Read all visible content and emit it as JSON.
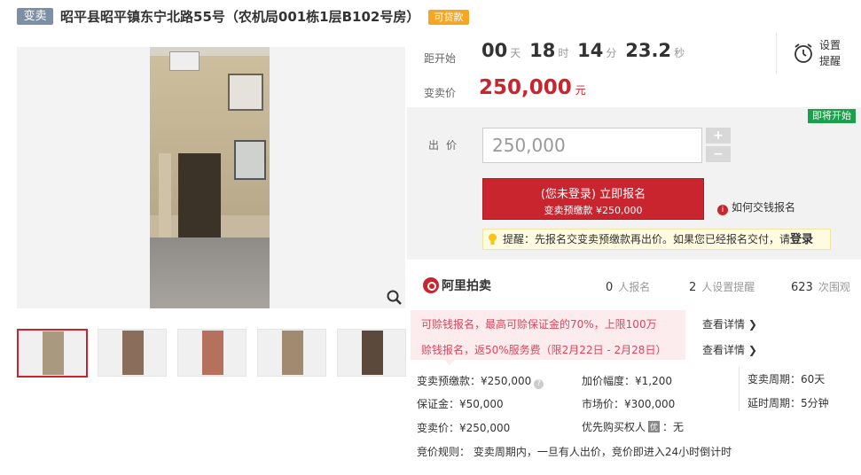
{
  "title": {
    "tag_sale": "变卖",
    "text": "昭平县昭平镇东宁北路55号（农机局001栋1层B102号房）",
    "tag_loan": "可贷款"
  },
  "countdown": {
    "label": "距开始",
    "days": "00",
    "days_unit": "天",
    "hours": "18",
    "hours_unit": "时",
    "minutes": "14",
    "minutes_unit": "分",
    "seconds": "23.2",
    "seconds_unit": "秒"
  },
  "remind": {
    "label": "设置提醒",
    "icon": "alarm-clock-icon"
  },
  "price": {
    "label": "变卖价",
    "value": "250,000",
    "unit": "元"
  },
  "bid": {
    "status_badge": "即将开始",
    "label": "出价",
    "value": "250,000",
    "increase": "+",
    "decrease": "−",
    "signup_line1": "(您未登录) 立即报名",
    "signup_line2": "变卖预缴款 ¥250,000",
    "howto": "如何交钱报名",
    "tip_text": "提醒：先报名交变卖预缴款再出价。如果您已经报名交付，请",
    "tip_login": "登录"
  },
  "platform": {
    "logo_text": "阿里拍卖",
    "signups": "0",
    "signups_unit": "人报名",
    "reminders": "2",
    "reminders_unit": "人设置提醒",
    "views": "623",
    "views_unit": "次围观"
  },
  "promo": {
    "line1": "可赊钱报名，最高可赊保证金的70%，上限100万",
    "line1_link": "查看详情 ❯",
    "line2": "赊钱报名，返50%服务费（限2月22日 - 2月28日）",
    "line2_link": "查看详情 ❯"
  },
  "info": {
    "prepay": "变卖预缴款：¥250,000",
    "increment": "加价幅度：¥1,200",
    "period": "变卖周期：60天",
    "deposit": "保证金：¥50,000",
    "market": "市场价：¥300,000",
    "delay": "延时周期：5分钟",
    "sale_price": "变卖价：¥250,000",
    "priority_label": "优先购买权人",
    "priority_badge": "优",
    "priority_value": "：无",
    "rule": "竞价规则： 变卖周期内，一旦有人出价，竞价即进入24小时倒计时"
  },
  "icons": {
    "zoom": "zoom-icon",
    "info": "info-icon",
    "bulb": "bulb-icon",
    "help": "question-icon"
  },
  "colors": {
    "accent": "#c9252f",
    "green": "#1aa04b",
    "loan": "#f5a623",
    "promo_text": "#e0445c"
  }
}
